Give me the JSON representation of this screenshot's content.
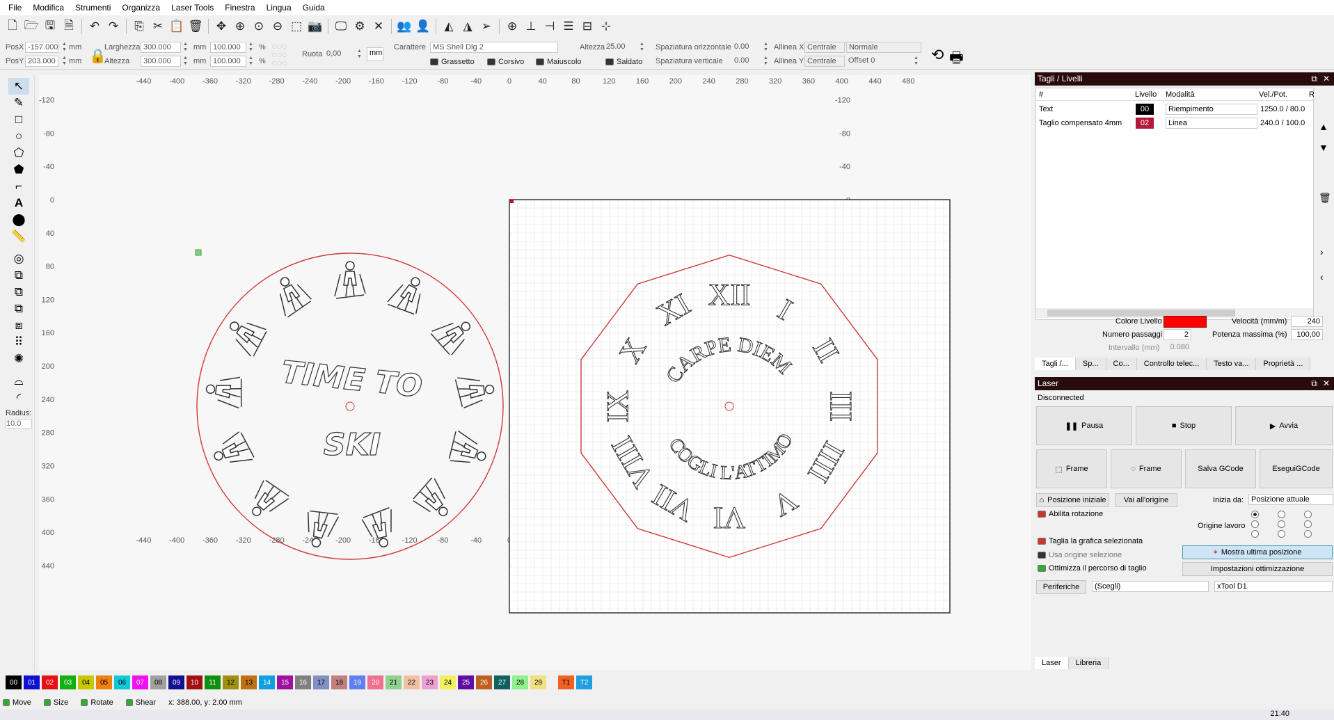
{
  "menu": [
    "File",
    "Modifica",
    "Strumenti",
    "Organizza",
    "Laser Tools",
    "Finestra",
    "Lingua",
    "Guida"
  ],
  "props": {
    "posx_label": "PosX",
    "posx": "-157.000",
    "posy_label": "PosY",
    "posy": "203.000",
    "unit": "mm",
    "width_label": "Larghezza",
    "width": "300.000",
    "height_label": "Altezza",
    "height": "300.000",
    "scale_w": "100.000",
    "scale_h": "100.000",
    "pct": "%",
    "rotate_label": "Ruota",
    "rotate": "0,00",
    "unit_btn": "mm",
    "font_label": "Carattere",
    "font": "MS Shell Dlg 2",
    "font_h_label": "Altezza",
    "font_h": "25.00",
    "hspace_label": "Spaziatura orizzontale",
    "hspace": "0.00",
    "vspace_label": "Spaziatura verticale",
    "vspace": "0.00",
    "alignx_label": "Allinea X",
    "alignx": "Centrale",
    "aligny_label": "Allinea Y",
    "aligny": "Centrale",
    "style": "Normale",
    "offset": "Offset 0",
    "bold": "Grassetto",
    "italic": "Corsivo",
    "upper": "Maiuscolo",
    "welded": "Saldato"
  },
  "ruler": {
    "top": [
      "-440",
      "-400",
      "-360",
      "-320",
      "-280",
      "-240",
      "-200",
      "-160",
      "-120",
      "-80",
      "-40",
      "0",
      "40",
      "80",
      "120",
      "160",
      "200",
      "240",
      "280",
      "320",
      "360",
      "400",
      "440",
      "480"
    ],
    "side": [
      "-120",
      "-80",
      "-40",
      "0",
      "40",
      "80",
      "120",
      "160",
      "200",
      "240",
      "280",
      "320",
      "360",
      "400",
      "440"
    ]
  },
  "left_radius": {
    "label": "Radius:",
    "value": "10.0"
  },
  "artwork": {
    "left_line1": "TIME TO",
    "left_line2": "SKI",
    "right_arc1": "CARPE DIEM",
    "right_arc2": "COGLI L'ATTIMO",
    "numerals": [
      "XII",
      "I",
      "II",
      "III",
      "IIII",
      "V",
      "VI",
      "VII",
      "VIII",
      "IX",
      "X",
      "XI"
    ]
  },
  "cuts": {
    "title": "Tagli / Livelli",
    "headers": [
      "#",
      "Livello",
      "Modalità",
      "Vel./Pot.",
      "R"
    ],
    "rows": [
      {
        "name": "Text",
        "layer": "00",
        "layer_color": "#000000",
        "mode": "Riempimento",
        "speed": "1250.0 / 80.0"
      },
      {
        "name": "Taglio compensato 4mm",
        "layer": "02",
        "layer_color": "#b3193a",
        "mode": "Linea",
        "speed": "240.0 / 100.0"
      }
    ],
    "layer_color_label": "Colore Livello",
    "speed_label": "Velocità (mm/m)",
    "speed_val": "240",
    "passes_label": "Numero passaggi",
    "passes_val": "2",
    "power_label": "Potenza massima (%)",
    "power_val": "100,00",
    "interval_label": "Intervallo (mm)",
    "interval_val": "0.080",
    "tabs": [
      "Tagli /...",
      "Sp...",
      "Co...",
      "Controllo telec...",
      "Testo va...",
      "Proprietà ..."
    ]
  },
  "laser": {
    "title": "Laser",
    "status": "Disconnected",
    "pause": "Pausa",
    "stop": "Stop",
    "start": "Avvia",
    "frame1": "Frame",
    "frame2": "Frame",
    "save_gcode": "Salva GCode",
    "run_gcode": "EseguiGCode",
    "home": "Posizione iniziale",
    "go_origin": "Vai all'origine",
    "start_from_label": "Inizia da:",
    "start_from": "Posizione attuale",
    "rotation": "Abilita rotazione",
    "origin_label": "Origine lavoro",
    "cut_selected": "Taglia la grafica selezionata",
    "use_sel_origin": "Usa origine selezione",
    "show_last": "Mostra ultima posizione",
    "optimize": "Ottimizza il percorso di taglio",
    "opt_settings": "Impostazioni ottimizzazione",
    "devices": "Periferiche",
    "choose": "(Scegli)",
    "machine": "xTool D1",
    "tabs": [
      "Laser",
      "Libreria"
    ]
  },
  "palette": [
    {
      "n": "00",
      "c": "#000000",
      "t": "#fff"
    },
    {
      "n": "01",
      "c": "#1010d0",
      "t": "#fff"
    },
    {
      "n": "02",
      "c": "#e81010",
      "t": "#fff"
    },
    {
      "n": "03",
      "c": "#10b010",
      "t": "#fff"
    },
    {
      "n": "04",
      "c": "#c8c800",
      "t": "#000"
    },
    {
      "n": "05",
      "c": "#f08010",
      "t": "#000"
    },
    {
      "n": "06",
      "c": "#10c8d8",
      "t": "#000"
    },
    {
      "n": "07",
      "c": "#f010f0",
      "t": "#fff"
    },
    {
      "n": "08",
      "c": "#a0a0a0",
      "t": "#000"
    },
    {
      "n": "09",
      "c": "#101090",
      "t": "#fff"
    },
    {
      "n": "10",
      "c": "#a01010",
      "t": "#fff"
    },
    {
      "n": "11",
      "c": "#109010",
      "t": "#fff"
    },
    {
      "n": "12",
      "c": "#a09010",
      "t": "#000"
    },
    {
      "n": "13",
      "c": "#c07010",
      "t": "#000"
    },
    {
      "n": "14",
      "c": "#10a0e0",
      "t": "#fff"
    },
    {
      "n": "15",
      "c": "#a010a0",
      "t": "#fff"
    },
    {
      "n": "16",
      "c": "#808080",
      "t": "#fff"
    },
    {
      "n": "17",
      "c": "#8090c0",
      "t": "#000"
    },
    {
      "n": "18",
      "c": "#c08080",
      "t": "#000"
    },
    {
      "n": "19",
      "c": "#6080f0",
      "t": "#fff"
    },
    {
      "n": "20",
      "c": "#f07090",
      "t": "#fff"
    },
    {
      "n": "21",
      "c": "#90d090",
      "t": "#000"
    },
    {
      "n": "22",
      "c": "#f0c0a0",
      "t": "#000"
    },
    {
      "n": "23",
      "c": "#f0a0d0",
      "t": "#000"
    },
    {
      "n": "24",
      "c": "#f0f060",
      "t": "#000"
    },
    {
      "n": "25",
      "c": "#6010a0",
      "t": "#fff"
    },
    {
      "n": "26",
      "c": "#c06020",
      "t": "#fff"
    },
    {
      "n": "27",
      "c": "#106060",
      "t": "#fff"
    },
    {
      "n": "28",
      "c": "#90f090",
      "t": "#000"
    },
    {
      "n": "29",
      "c": "#f0e080",
      "t": "#000"
    },
    {
      "n": "T1",
      "c": "#f06020",
      "t": "#000"
    },
    {
      "n": "T2",
      "c": "#20a0e0",
      "t": "#fff"
    }
  ],
  "status": {
    "move": "Move",
    "size": "Size",
    "rotate": "Rotate",
    "shear": "Shear",
    "coords": "x: 388.00, y: 2.00 mm"
  },
  "clock": "21:40"
}
